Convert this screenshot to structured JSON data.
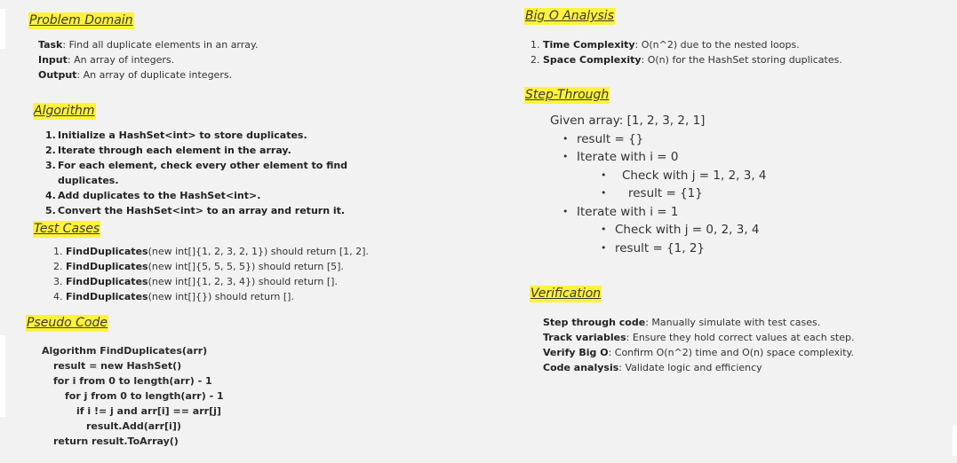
{
  "problem_domain": {
    "heading": "Problem Domain",
    "rows": [
      {
        "key": "Task",
        "text": ": Find all duplicate elements in an array."
      },
      {
        "key": "Input",
        "text": ": An array of integers."
      },
      {
        "key": "Output",
        "text": ": An array of duplicate integers."
      }
    ]
  },
  "algorithm": {
    "heading": "Algorithm",
    "steps": [
      {
        "num": "1.",
        "text": "Initialize a HashSet<int> to store duplicates."
      },
      {
        "num": "2.",
        "text": "Iterate through each element in the array."
      },
      {
        "num": "3.",
        "text": "For each element, check every other element to find",
        "cont": "duplicates."
      },
      {
        "num": "4.",
        "text": "Add duplicates to the HashSet<int>."
      },
      {
        "num": "5.",
        "text": "Convert the HashSet<int> to an array and return it."
      }
    ]
  },
  "test_cases": {
    "heading": "Test Cases",
    "items": [
      {
        "num": "1.",
        "key": "FindDuplicates",
        "text": "(new int[]{1, 2, 3, 2, 1}) should return [1, 2]."
      },
      {
        "num": "2.",
        "key": "FindDuplicates",
        "text": "(new int[]{5, 5, 5, 5}) should return [5]."
      },
      {
        "num": "3.",
        "key": "FindDuplicates",
        "text": "(new int[]{1, 2, 3, 4}) should return []."
      },
      {
        "num": "4.",
        "key": "FindDuplicates",
        "text": "(new int[]{}) should return []."
      }
    ]
  },
  "pseudo_code": {
    "heading": "Pseudo Code",
    "lines": [
      "Algorithm FindDuplicates(arr)",
      "result = new HashSet()",
      "for i from 0 to length(arr) - 1",
      "for j from 0 to length(arr) - 1",
      "if i != j and arr[i] == arr[j]",
      "result.Add(arr[i])",
      "return result.ToArray()"
    ]
  },
  "big_o": {
    "heading": "Big O Analysis",
    "items": [
      {
        "num": "1.",
        "key": "Time Complexity",
        "text": ": O(n^2) due to the nested loops."
      },
      {
        "num": "2.",
        "key": "Space Complexity",
        "text": ": O(n) for the HashSet storing duplicates."
      }
    ]
  },
  "step_through": {
    "heading": "Step-Through",
    "given": "Given array: [1, 2, 3, 2, 1]",
    "bullets": [
      {
        "bullet": "•",
        "text": "result = {}"
      },
      {
        "bullet": "•",
        "text": "Iterate with i = 0"
      },
      {
        "bullet": "•",
        "text": "Check with j = 1, 2, 3, 4"
      },
      {
        "bullet": "•",
        "text": "result = {1}"
      },
      {
        "bullet": "•",
        "text": "Iterate with i = 1"
      },
      {
        "bullet": "•",
        "text": "Check with j = 0, 2, 3, 4"
      },
      {
        "bullet": "•",
        "text": "result = {1, 2}"
      }
    ]
  },
  "verification": {
    "heading": "Verification",
    "rows": [
      {
        "key": "Step through code",
        "text": ": Manually simulate with test cases."
      },
      {
        "key": "Track variables",
        "text": ": Ensure they hold correct values at each step."
      },
      {
        "key": "Verify Big O",
        "text": ": Confirm O(n^2) time and O(n) space complexity."
      },
      {
        "key": "Code analysis",
        "text": ": Validate logic and efficiency"
      }
    ]
  },
  "colors": {
    "highlight": "#fff23a",
    "background": "#f2f2f2"
  }
}
